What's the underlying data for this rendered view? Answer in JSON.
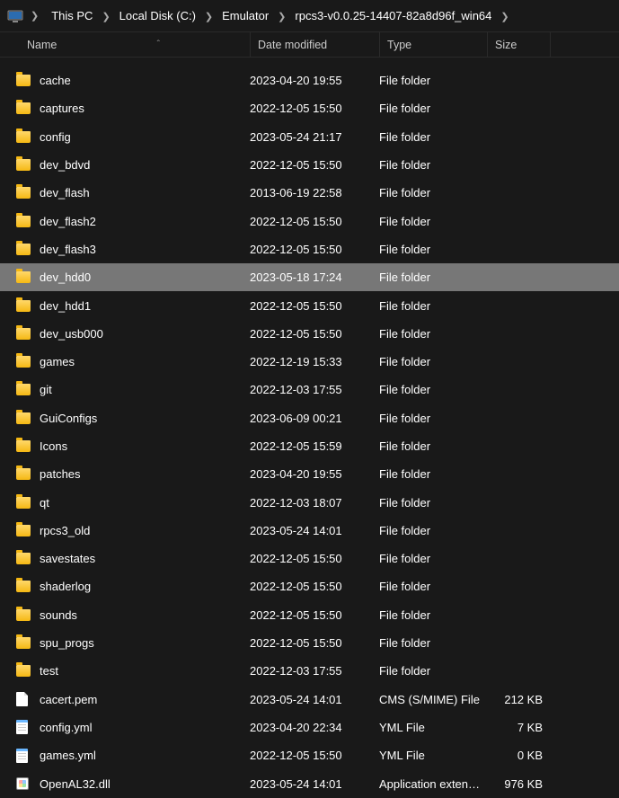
{
  "breadcrumb": {
    "items": [
      "This PC",
      "Local Disk (C:)",
      "Emulator",
      "rpcs3-v0.0.25-14407-82a8d96f_win64"
    ]
  },
  "columns": {
    "name": "Name",
    "date": "Date modified",
    "type": "Type",
    "size": "Size",
    "sort_indicator": "ˆ"
  },
  "items": [
    {
      "icon": "folder",
      "name": "cache",
      "date": "2023-04-20 19:55",
      "type": "File folder",
      "size": "",
      "selected": false
    },
    {
      "icon": "folder",
      "name": "captures",
      "date": "2022-12-05 15:50",
      "type": "File folder",
      "size": "",
      "selected": false
    },
    {
      "icon": "folder",
      "name": "config",
      "date": "2023-05-24 21:17",
      "type": "File folder",
      "size": "",
      "selected": false
    },
    {
      "icon": "folder",
      "name": "dev_bdvd",
      "date": "2022-12-05 15:50",
      "type": "File folder",
      "size": "",
      "selected": false
    },
    {
      "icon": "folder",
      "name": "dev_flash",
      "date": "2013-06-19 22:58",
      "type": "File folder",
      "size": "",
      "selected": false
    },
    {
      "icon": "folder",
      "name": "dev_flash2",
      "date": "2022-12-05 15:50",
      "type": "File folder",
      "size": "",
      "selected": false
    },
    {
      "icon": "folder",
      "name": "dev_flash3",
      "date": "2022-12-05 15:50",
      "type": "File folder",
      "size": "",
      "selected": false
    },
    {
      "icon": "folder",
      "name": "dev_hdd0",
      "date": "2023-05-18 17:24",
      "type": "File folder",
      "size": "",
      "selected": true
    },
    {
      "icon": "folder",
      "name": "dev_hdd1",
      "date": "2022-12-05 15:50",
      "type": "File folder",
      "size": "",
      "selected": false
    },
    {
      "icon": "folder",
      "name": "dev_usb000",
      "date": "2022-12-05 15:50",
      "type": "File folder",
      "size": "",
      "selected": false
    },
    {
      "icon": "folder",
      "name": "games",
      "date": "2022-12-19 15:33",
      "type": "File folder",
      "size": "",
      "selected": false
    },
    {
      "icon": "folder",
      "name": "git",
      "date": "2022-12-03 17:55",
      "type": "File folder",
      "size": "",
      "selected": false
    },
    {
      "icon": "folder",
      "name": "GuiConfigs",
      "date": "2023-06-09 00:21",
      "type": "File folder",
      "size": "",
      "selected": false
    },
    {
      "icon": "folder",
      "name": "Icons",
      "date": "2022-12-05 15:59",
      "type": "File folder",
      "size": "",
      "selected": false
    },
    {
      "icon": "folder",
      "name": "patches",
      "date": "2023-04-20 19:55",
      "type": "File folder",
      "size": "",
      "selected": false
    },
    {
      "icon": "folder",
      "name": "qt",
      "date": "2022-12-03 18:07",
      "type": "File folder",
      "size": "",
      "selected": false
    },
    {
      "icon": "folder",
      "name": "rpcs3_old",
      "date": "2023-05-24 14:01",
      "type": "File folder",
      "size": "",
      "selected": false
    },
    {
      "icon": "folder",
      "name": "savestates",
      "date": "2022-12-05 15:50",
      "type": "File folder",
      "size": "",
      "selected": false
    },
    {
      "icon": "folder",
      "name": "shaderlog",
      "date": "2022-12-05 15:50",
      "type": "File folder",
      "size": "",
      "selected": false
    },
    {
      "icon": "folder",
      "name": "sounds",
      "date": "2022-12-05 15:50",
      "type": "File folder",
      "size": "",
      "selected": false
    },
    {
      "icon": "folder",
      "name": "spu_progs",
      "date": "2022-12-05 15:50",
      "type": "File folder",
      "size": "",
      "selected": false
    },
    {
      "icon": "folder",
      "name": "test",
      "date": "2022-12-03 17:55",
      "type": "File folder",
      "size": "",
      "selected": false
    },
    {
      "icon": "file",
      "name": "cacert.pem",
      "date": "2023-05-24 14:01",
      "type": "CMS (S/MIME) File",
      "size": "212 KB",
      "selected": false
    },
    {
      "icon": "note",
      "name": "config.yml",
      "date": "2023-04-20 22:34",
      "type": "YML File",
      "size": "7 KB",
      "selected": false
    },
    {
      "icon": "note",
      "name": "games.yml",
      "date": "2022-12-05 15:50",
      "type": "YML File",
      "size": "0 KB",
      "selected": false
    },
    {
      "icon": "app",
      "name": "OpenAL32.dll",
      "date": "2023-05-24 14:01",
      "type": "Application exten…",
      "size": "976 KB",
      "selected": false
    }
  ]
}
